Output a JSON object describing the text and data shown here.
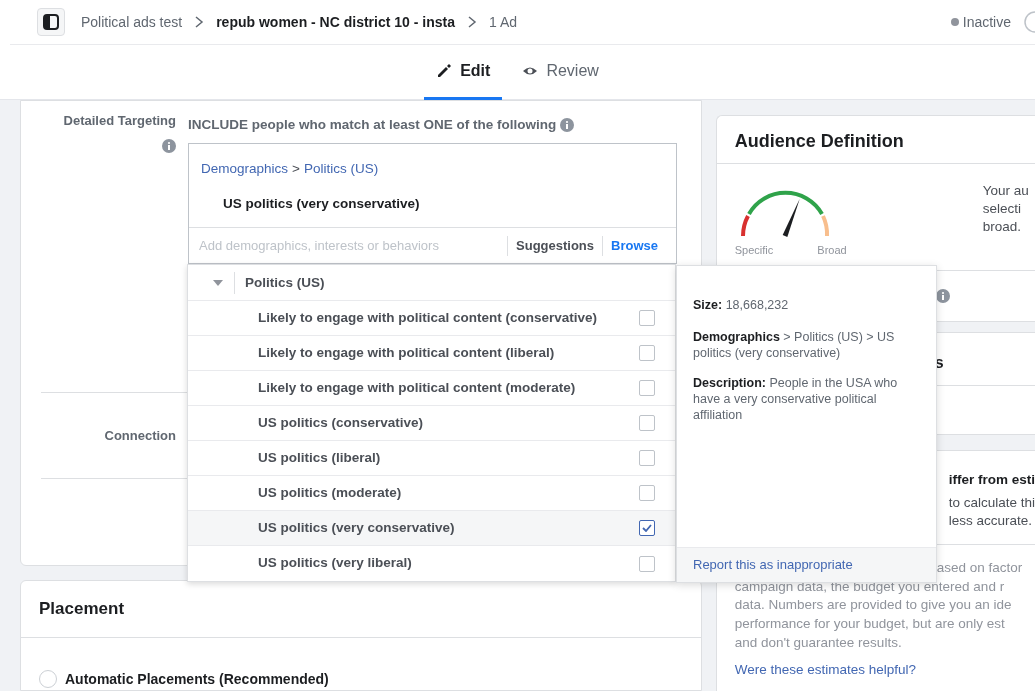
{
  "top_bar": {
    "breadcrumb": [
      {
        "label": "Political ads test",
        "current": false
      },
      {
        "label": "repub women - NC district 10 - insta",
        "current": true
      },
      {
        "label": "1 Ad",
        "current": false
      }
    ],
    "status": "Inactive"
  },
  "tabs": [
    {
      "label": "Edit",
      "kind": "edit",
      "selected": true
    },
    {
      "label": "Review",
      "kind": "review",
      "selected": false
    }
  ],
  "detailed_targeting": {
    "label": "Detailed Targeting",
    "include_text": "INCLUDE people who match at least ONE of the following",
    "selection": {
      "path": [
        "Demographics",
        "Politics (US)"
      ],
      "separator": ">",
      "item": "US politics (very conservative)"
    },
    "search": {
      "placeholder": "Add demographics, interests or behaviors"
    },
    "modes": [
      {
        "label": "Suggestions",
        "selected": false
      },
      {
        "label": "Browse",
        "selected": true
      }
    ]
  },
  "browse_dropdown": {
    "category": "Politics (US)",
    "expanded": true,
    "options": [
      {
        "label": "Likely to engage with political content (conservative)",
        "checked": false
      },
      {
        "label": "Likely to engage with political content (liberal)",
        "checked": false
      },
      {
        "label": "Likely to engage with political content (moderate)",
        "checked": false
      },
      {
        "label": "US politics (conservative)",
        "checked": false
      },
      {
        "label": "US politics (liberal)",
        "checked": false
      },
      {
        "label": "US politics (moderate)",
        "checked": false
      },
      {
        "label": "US politics (very conservative)",
        "checked": true
      },
      {
        "label": "US politics (very liberal)",
        "checked": false
      }
    ]
  },
  "connections": {
    "label": "Connection"
  },
  "placement": {
    "title": "Placement",
    "options": [
      {
        "label": "Automatic Placements (Recommended)",
        "selected": false
      }
    ]
  },
  "audience_definition": {
    "title": "Audience Definition",
    "gauge": {
      "level": 0.62,
      "low_label": "Specific",
      "high_label": "Broad"
    },
    "summary_lines": [
      "Your au",
      "selecti",
      "broad."
    ]
  },
  "estimates": {
    "heading_fragment": "s",
    "notice_title": "iffer from esti",
    "notice_lines": [
      "to calculate thi",
      "less accurate."
    ],
    "disclaimer_lines": [
      "ased on factor",
      "campaign data, the budget you entered and r",
      "data. Numbers are provided to give you an ide",
      "performance for your budget, but are only est",
      "and don't guarantee results."
    ],
    "feedback_link": "Were these estimates helpful?"
  },
  "tooltip": {
    "size_label": "Size:",
    "size": "18,668,232",
    "path": [
      "Demographics",
      "Politics (US)",
      "US politics (very conservative)"
    ],
    "separator": ">",
    "description_label": "Description:",
    "description": "People in the USA who have a very conservative political affiliation",
    "report_link": "Report this as inappropriate"
  }
}
